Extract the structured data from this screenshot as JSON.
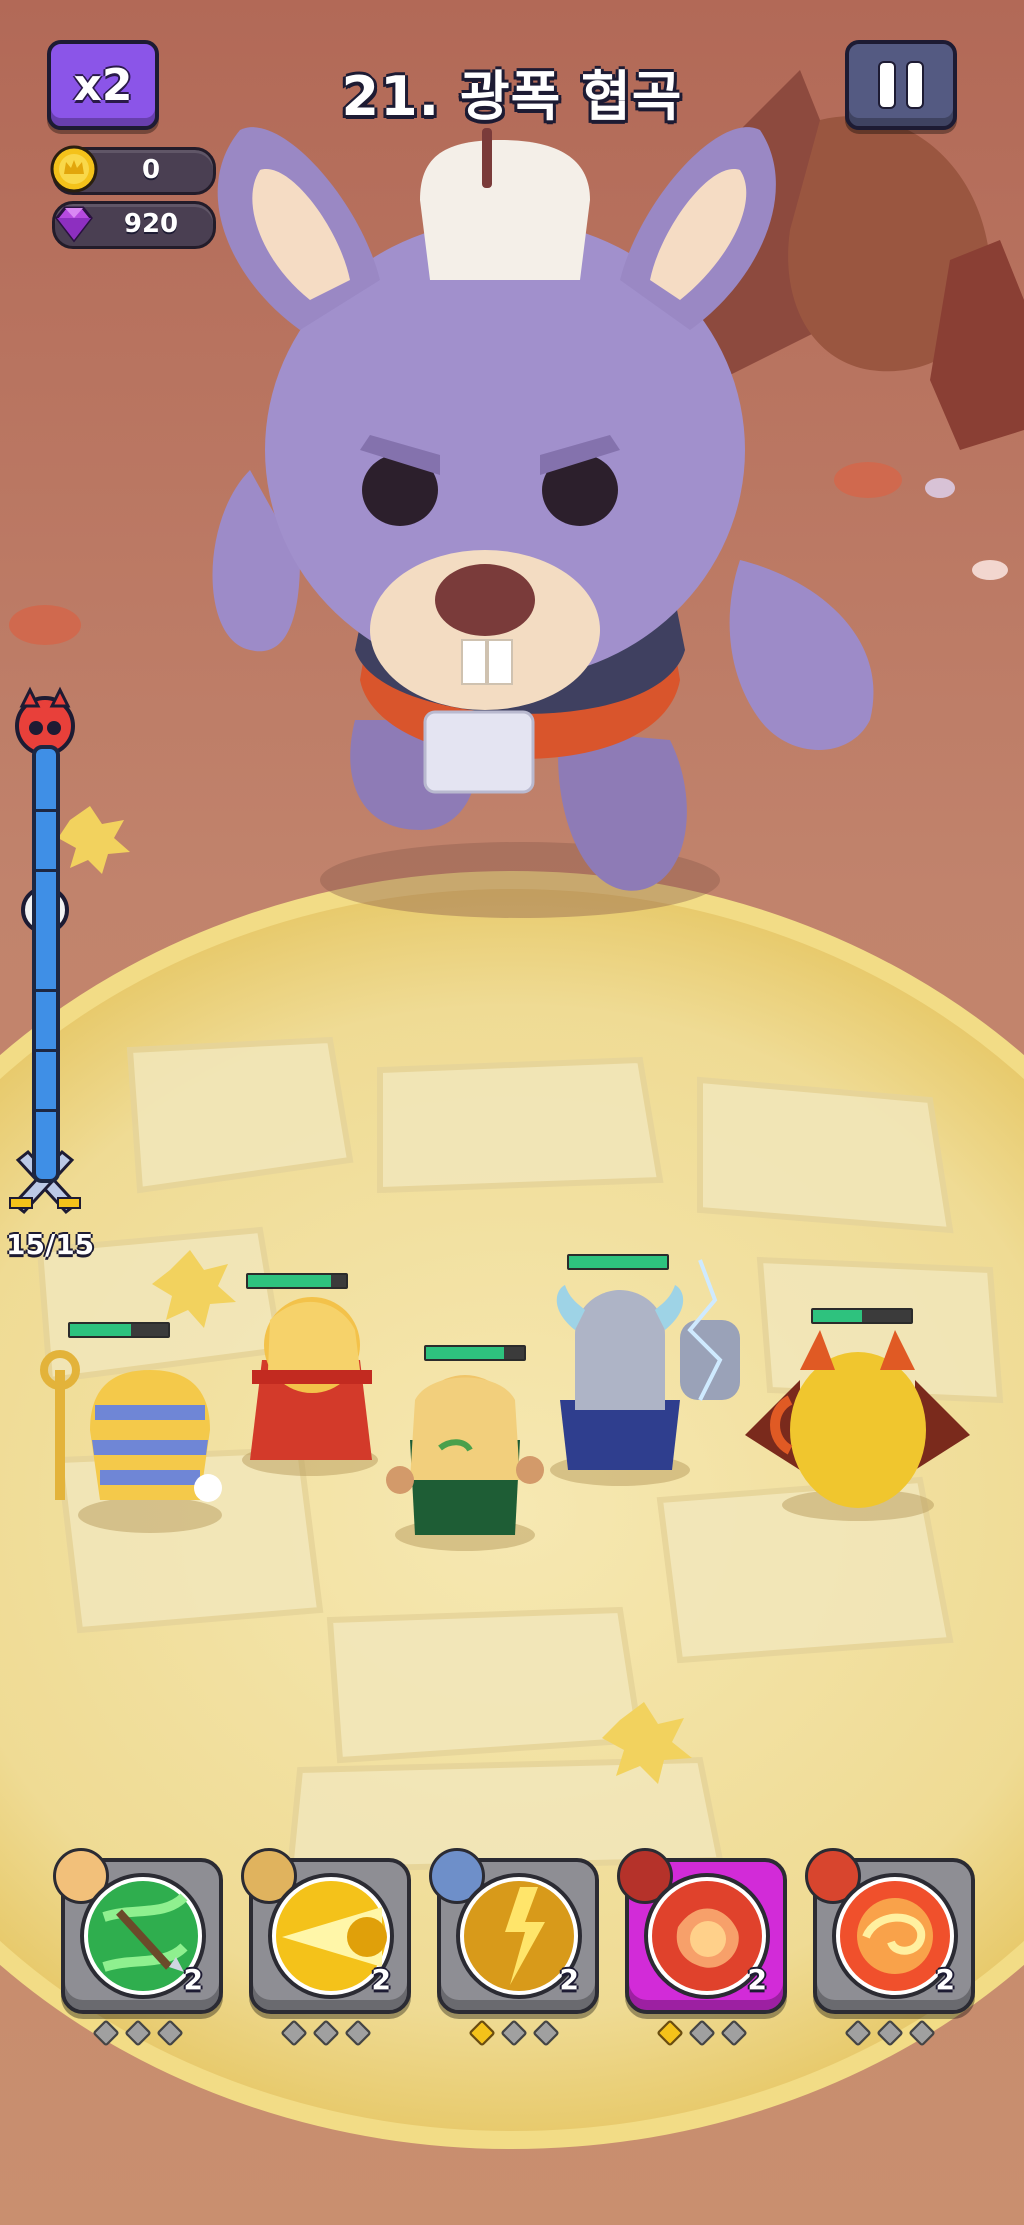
{
  "top_bar": {
    "speed_label": "x2",
    "stage_title": "21. 광폭 협곡",
    "pause_icon": "pause-icon"
  },
  "resources": {
    "gold": {
      "icon": "crown-coin-icon",
      "value": "0"
    },
    "gems": {
      "icon": "purple-gem-icon",
      "value": "920"
    }
  },
  "wave_progress": {
    "count_text": "15/15",
    "boss_icon": "red-demon-skull-icon",
    "mid_icon": "white-demon-skull-icon",
    "start_icon": "crossed-swords-icon"
  },
  "heroes": [
    {
      "name": "pharaoh-hero",
      "hp_fraction": 0.62
    },
    {
      "name": "red-cape-hero",
      "hp_fraction": 0.85
    },
    {
      "name": "elf-archer-hero",
      "hp_fraction": 0.8
    },
    {
      "name": "viking-thunder-hero",
      "hp_fraction": 1.0
    },
    {
      "name": "fire-dragon-hero",
      "hp_fraction": 0.5
    }
  ],
  "skills": [
    {
      "icon": "green-spear-skill-icon",
      "hero_avatar": "elf-avatar",
      "level": "2",
      "stars": 0,
      "active": false
    },
    {
      "icon": "golden-beam-skill-icon",
      "hero_avatar": "pharaoh-avatar",
      "level": "2",
      "stars": 0,
      "active": false
    },
    {
      "icon": "lightning-skill-icon",
      "hero_avatar": "viking-avatar",
      "level": "2",
      "stars": 1,
      "active": false
    },
    {
      "icon": "fire-fist-skill-icon",
      "hero_avatar": "dragon-avatar",
      "level": "2",
      "stars": 1,
      "active": true
    },
    {
      "icon": "fire-vortex-skill-icon",
      "hero_avatar": "red-cape-avatar",
      "level": "2",
      "stars": 0,
      "active": false
    }
  ],
  "colors": {
    "ground": "#b9725f",
    "arena": "#f0df9c",
    "speed_button": "#8b55e8",
    "pause_button": "#545a82",
    "active_skill": "#d22bd8",
    "hp_green": "#2ec27e",
    "boss_purple": "#9a88c4"
  }
}
